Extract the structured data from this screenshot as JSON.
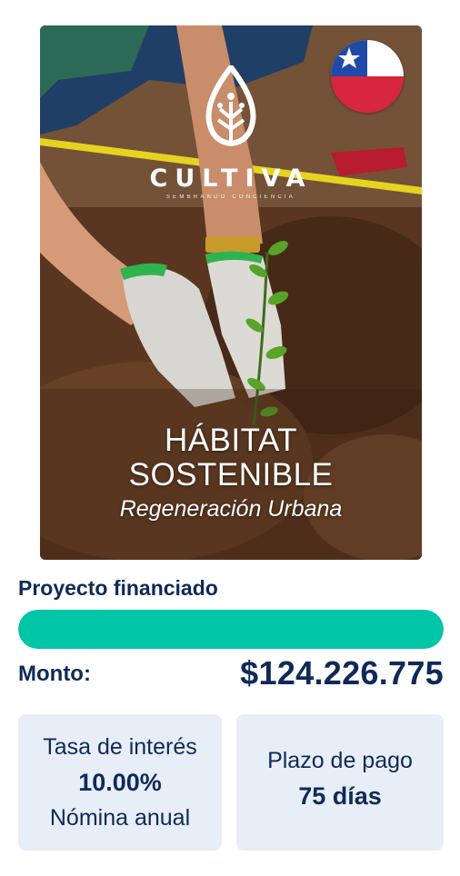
{
  "card": {
    "brand_name": "CULTIVA",
    "brand_tagline": "SEMBRANDO CONCIENCIA",
    "title_line1": "HÁBITAT",
    "title_line2": "SOSTENIBLE",
    "subtitle": "Regeneración Urbana",
    "flag_icon": "chile-flag-icon",
    "logo_icon": "leaf-logo-icon"
  },
  "progress": {
    "label": "Proyecto financiado",
    "percent": 100,
    "color": "#00c5a7"
  },
  "amount": {
    "label": "Monto:",
    "value": "$124.226.775"
  },
  "rate": {
    "title": "Tasa de interés",
    "value": "10.00%",
    "note": "Nómina anual"
  },
  "term": {
    "title": "Plazo de pago",
    "value": "75 días"
  },
  "colors": {
    "text": "#0f2a57",
    "accent": "#00c5a7",
    "box_bg": "#e8eef8"
  }
}
